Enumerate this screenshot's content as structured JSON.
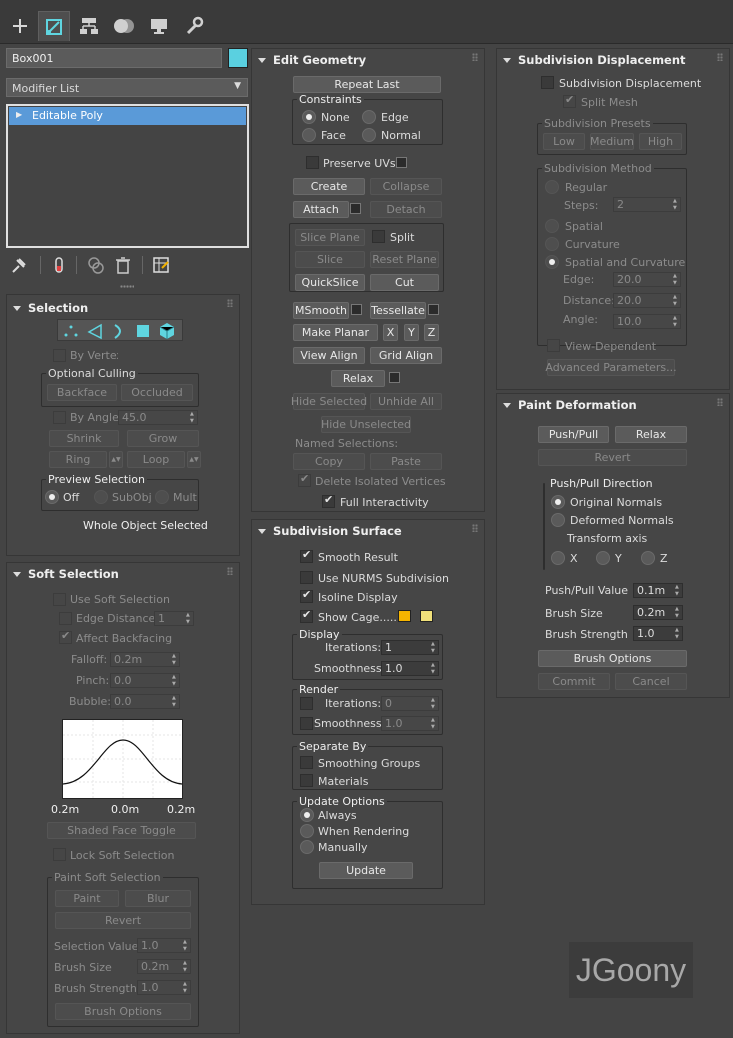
{
  "toolbar": {
    "tabs": [
      "create-icon",
      "modify-icon",
      "hierarchy-icon",
      "motion-icon",
      "display-icon",
      "utilities-icon"
    ]
  },
  "object": {
    "name": "Box001",
    "color": "#5ad0e0"
  },
  "modifier_list": {
    "label": "Modifier List"
  },
  "stack": {
    "item": "Editable Poly"
  },
  "selection": {
    "title": "Selection",
    "by_vertex": "By Vertex",
    "optional_culling": "Optional Culling",
    "backface": "Backface",
    "occluded": "Occluded",
    "by_angle": "By Angle:",
    "angle_value": "45.0",
    "shrink": "Shrink",
    "grow": "Grow",
    "ring": "Ring",
    "loop": "Loop",
    "preview_selection": "Preview Selection",
    "off": "Off",
    "subobj": "SubObj",
    "multi": "Multi",
    "status": "Whole Object Selected"
  },
  "soft": {
    "title": "Soft Selection",
    "use_soft": "Use Soft Selection",
    "edge_distance": "Edge Distance:",
    "edge_distance_value": "1",
    "affect_backfacing": "Affect Backfacing",
    "falloff": "Falloff:",
    "falloff_value": "0.2m",
    "pinch": "Pinch:",
    "pinch_value": "0.0",
    "bubble": "Bubble:",
    "bubble_value": "0.0",
    "axis_left": "0.2m",
    "axis_mid": "0.0m",
    "axis_right": "0.2m",
    "shaded_face_toggle": "Shaded Face Toggle",
    "lock_soft": "Lock Soft Selection",
    "paint_soft": "Paint Soft Selection",
    "paint": "Paint",
    "blur": "Blur",
    "revert": "Revert",
    "selection_value": "Selection Value",
    "selection_value_v": "1.0",
    "brush_size": "Brush Size",
    "brush_size_v": "0.2m",
    "brush_strength": "Brush Strength",
    "brush_strength_v": "1.0",
    "brush_options": "Brush Options"
  },
  "edit_geometry": {
    "title": "Edit Geometry",
    "repeat_last": "Repeat Last",
    "constraints": "Constraints",
    "none": "None",
    "edge": "Edge",
    "face": "Face",
    "normal": "Normal",
    "preserve_uvs": "Preserve UVs",
    "create": "Create",
    "collapse": "Collapse",
    "attach": "Attach",
    "detach": "Detach",
    "slice_plane": "Slice Plane",
    "split": "Split",
    "slice": "Slice",
    "reset_plane": "Reset Plane",
    "quickslice": "QuickSlice",
    "cut": "Cut",
    "msmooth": "MSmooth",
    "tessellate": "Tessellate",
    "make_planar": "Make Planar",
    "x": "X",
    "y": "Y",
    "z": "Z",
    "view_align": "View Align",
    "grid_align": "Grid Align",
    "relax": "Relax",
    "hide_selected": "Hide Selected",
    "unhide_all": "Unhide All",
    "hide_unselected": "Hide Unselected",
    "named_selections": "Named Selections:",
    "copy": "Copy",
    "paste": "Paste",
    "delete_isolated": "Delete Isolated Vertices",
    "full_interactivity": "Full Interactivity"
  },
  "subdiv_surface": {
    "title": "Subdivision Surface",
    "smooth_result": "Smooth Result",
    "use_nurms": "Use NURMS Subdivision",
    "isoline_display": "Isoline Display",
    "show_cage": "Show Cage......",
    "cage_color1": "#f5b400",
    "cage_color2": "#f0e07a",
    "display": "Display",
    "iterations": "Iterations:",
    "iterations_v": "1",
    "smoothness": "Smoothness:",
    "smoothness_v": "1.0",
    "render": "Render",
    "r_iterations_v": "0",
    "r_smoothness_v": "1.0",
    "separate_by": "Separate By",
    "smoothing_groups": "Smoothing Groups",
    "materials": "Materials",
    "update_options": "Update Options",
    "always": "Always",
    "when_rendering": "When Rendering",
    "manually": "Manually",
    "update": "Update"
  },
  "subdiv_displacement": {
    "title": "Subdivision Displacement",
    "subdivision_displacement": "Subdivision Displacement",
    "split_mesh": "Split Mesh",
    "presets": "Subdivision Presets",
    "low": "Low",
    "medium": "Medium",
    "high": "High",
    "method": "Subdivision Method",
    "regular": "Regular",
    "steps": "Steps:",
    "steps_v": "2",
    "spatial": "Spatial",
    "curvature": "Curvature",
    "spatial_curvature": "Spatial and Curvature",
    "edge": "Edge:",
    "edge_v": "20.0",
    "distance": "Distance:",
    "distance_v": "20.0",
    "angle": "Angle:",
    "angle_v": "10.0",
    "view_dependent": "View-Dependent",
    "advanced": "Advanced Parameters..."
  },
  "paint_deformation": {
    "title": "Paint Deformation",
    "push_pull": "Push/Pull",
    "relax": "Relax",
    "revert": "Revert",
    "direction": "Push/Pull Direction",
    "original_normals": "Original Normals",
    "deformed_normals": "Deformed Normals",
    "transform_axis": "Transform axis",
    "x": "X",
    "y": "Y",
    "z": "Z",
    "push_pull_value": "Push/Pull Value",
    "push_pull_value_v": "0.1m",
    "brush_size": "Brush Size",
    "brush_size_v": "0.2m",
    "brush_strength": "Brush Strength",
    "brush_strength_v": "1.0",
    "brush_options": "Brush Options",
    "commit": "Commit",
    "cancel": "Cancel"
  },
  "watermark": {
    "text": "JGoony"
  }
}
